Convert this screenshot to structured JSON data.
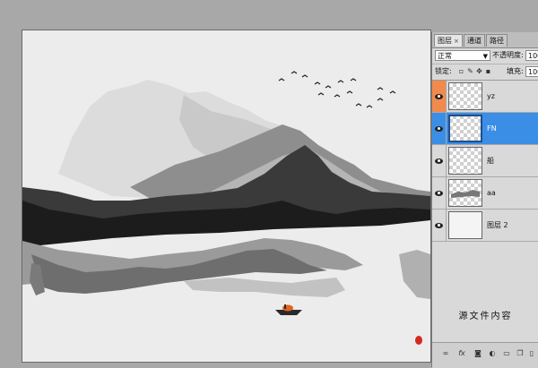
{
  "panel": {
    "tabs": [
      {
        "label": "图层",
        "close": "×"
      },
      {
        "label": "通道"
      },
      {
        "label": "路径"
      }
    ],
    "blend_mode": "正常",
    "opacity_label": "不透明度:",
    "opacity_value": "100",
    "lock_label": "锁定:",
    "fill_label": "填充:",
    "fill_value": "100",
    "layers": [
      {
        "name": "yz",
        "visible": true,
        "selected": false
      },
      {
        "name": "FN",
        "visible": true,
        "selected": true
      },
      {
        "name": "船",
        "visible": true,
        "selected": false
      },
      {
        "name": "aa",
        "visible": true,
        "selected": false
      },
      {
        "name": "图层 2",
        "visible": true,
        "selected": false
      }
    ],
    "overlay_text": "源文件内容",
    "footer_icons": [
      "link-icon",
      "fx-icon",
      "mask-icon",
      "adjustment-icon",
      "group-icon",
      "new-layer-icon",
      "trash-icon"
    ]
  },
  "colors": {
    "selected_layer": "#3a8ee6",
    "eye_highlight": "#f28a4c",
    "seal": "#d42a1e"
  }
}
